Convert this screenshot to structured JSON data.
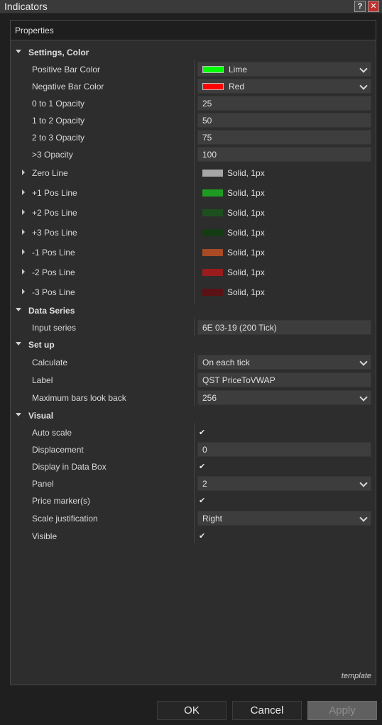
{
  "window": {
    "title": "Indicators",
    "help_glyph": "?",
    "close_glyph": "✕"
  },
  "panel": {
    "header": "Properties",
    "template_link": "template"
  },
  "categories": {
    "settings": "Settings, Color",
    "data_series": "Data Series",
    "setup": "Set up",
    "visual": "Visual"
  },
  "settings": {
    "positive_bar_color": {
      "label": "Positive Bar Color",
      "value": "Lime",
      "color": "#00ff00"
    },
    "negative_bar_color": {
      "label": "Negative Bar Color",
      "value": "Red",
      "color": "#ff0000"
    },
    "opacity_0_1": {
      "label": "0 to 1 Opacity",
      "value": "25"
    },
    "opacity_1_2": {
      "label": "1 to 2 Opacity",
      "value": "50"
    },
    "opacity_2_3": {
      "label": "2 to 3 Opacity",
      "value": "75"
    },
    "opacity_3": {
      "label": ">3 Opacity",
      "value": "100"
    },
    "lines": [
      {
        "label": "Zero Line",
        "value": "Solid, 1px",
        "color": "#a6a6a6"
      },
      {
        "label": "+1 Pos Line",
        "value": "Solid, 1px",
        "color": "#1f9a22"
      },
      {
        "label": "+2 Pos Line",
        "value": "Solid, 1px",
        "color": "#1e4f1e"
      },
      {
        "label": "+3 Pos Line",
        "value": "Solid, 1px",
        "color": "#153b15"
      },
      {
        "label": "-1 Pos Line",
        "value": "Solid, 1px",
        "color": "#a84a24"
      },
      {
        "label": "-2 Pos Line",
        "value": "Solid, 1px",
        "color": "#9a1c1c"
      },
      {
        "label": "-3 Pos Line",
        "value": "Solid, 1px",
        "color": "#5a1214"
      }
    ]
  },
  "data_series": {
    "input_series": {
      "label": "Input series",
      "value": "6E 03-19 (200 Tick)"
    }
  },
  "setup": {
    "calculate": {
      "label": "Calculate",
      "value": "On each tick"
    },
    "label": {
      "label": "Label",
      "value": "QST PriceToVWAP"
    },
    "max_bars": {
      "label": "Maximum bars look back",
      "value": "256"
    }
  },
  "visual": {
    "auto_scale": {
      "label": "Auto scale",
      "checked": true
    },
    "displacement": {
      "label": "Displacement",
      "value": "0"
    },
    "display_data_box": {
      "label": "Display in Data Box",
      "checked": true
    },
    "panel": {
      "label": "Panel",
      "value": "2"
    },
    "price_markers": {
      "label": "Price marker(s)",
      "checked": true
    },
    "scale_justification": {
      "label": "Scale justification",
      "value": "Right"
    },
    "visible": {
      "label": "Visible",
      "checked": true
    },
    "check_glyph": "✔"
  },
  "buttons": {
    "ok": "OK",
    "cancel": "Cancel",
    "apply": "Apply"
  }
}
